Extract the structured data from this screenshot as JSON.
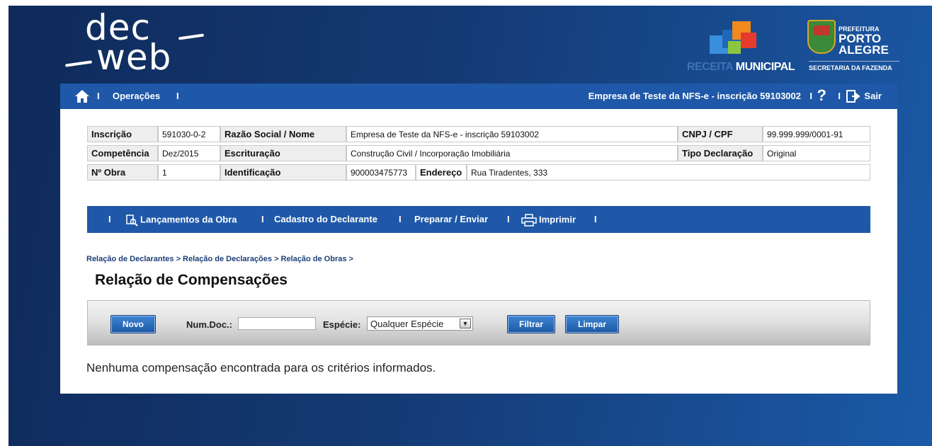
{
  "logo": {
    "line1": "dec",
    "line2": "web"
  },
  "brand": {
    "receita_word1": "RECEITA",
    "receita_word2": "MUNICIPAL",
    "prefeitura_small": "PREFEITURA",
    "prefeitura_line1": "PORTO",
    "prefeitura_line2": "ALEGRE",
    "secretaria": "SECRETARIA DA FAZENDA"
  },
  "topnav": {
    "home_icon": "home-icon",
    "separator": "I",
    "operacoes": "Operações",
    "empresa": "Empresa de Teste da NFS-e - inscrição 59103002",
    "help": "?",
    "sair": "Sair"
  },
  "info": {
    "inscricao_label": "Inscrição",
    "inscricao_value": "591030-0-2",
    "razao_label": "Razão Social / Nome",
    "razao_value": "Empresa de Teste da NFS-e - inscrição 59103002",
    "cnpj_label": "CNPJ / CPF",
    "cnpj_value": "99.999.999/0001-91",
    "competencia_label": "Competência",
    "competencia_value": "Dez/2015",
    "escrituracao_label": "Escrituração",
    "escrituracao_value": "Construção Civil / Incorporação Imobiliária",
    "tipo_label": "Tipo Declaração",
    "tipo_value": "Original",
    "obra_label": "Nº Obra",
    "obra_value": "1",
    "identificacao_label": "Identificação",
    "identificacao_value": "900003475773",
    "endereco_label": "Endereço",
    "endereco_value": "Rua Tiradentes, 333"
  },
  "subnav": {
    "separator": "I",
    "lancamentos": "Lançamentos da Obra",
    "cadastro": "Cadastro do Declarante",
    "preparar": "Preparar / Enviar",
    "imprimir": "Imprimir"
  },
  "breadcrumb": "Relação de Declarantes > Relação de Declarações > Relação de Obras >",
  "page_title": "Relação de Compensações",
  "filter": {
    "novo": "Novo",
    "numdoc_label": "Num.Doc.:",
    "numdoc_value": "",
    "especie_label": "Espécie:",
    "especie_selected": "Qualquer Espécie",
    "filtrar": "Filtrar",
    "limpar": "Limpar"
  },
  "empty_message": "Nenhuma compensação encontrada para os critérios informados."
}
